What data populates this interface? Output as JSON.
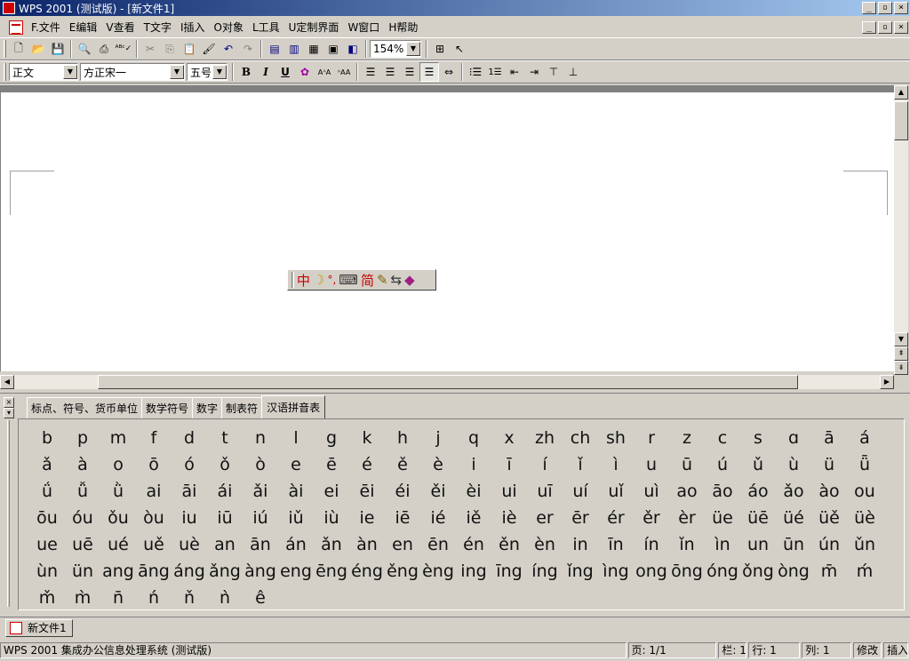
{
  "window": {
    "title": "WPS 2001 (测试版) - [新文件1]"
  },
  "menus": [
    "F.文件",
    "E编辑",
    "V查看",
    "T文字",
    "I插入",
    "O对象",
    "L工具",
    "U定制界面",
    "W窗口",
    "H帮助"
  ],
  "toolbar1": {
    "zoom": "154%",
    "icons": [
      "new-doc-icon",
      "open-folder-icon",
      "save-icon",
      "print-preview-icon",
      "print-icon",
      "spellcheck-icon",
      "cut-icon",
      "copy-icon",
      "paste-icon",
      "format-painter-icon",
      "undo-icon",
      "redo-icon",
      "columns-icon",
      "insert-column-icon",
      "table-icon",
      "image-icon",
      "frame-icon"
    ]
  },
  "toolbar2": {
    "style": "正文",
    "font": "方正宋一",
    "size": "五号",
    "buttons": {
      "bold": "B",
      "italic": "I",
      "underline": "U"
    }
  },
  "ime": {
    "glyphs": [
      "中",
      "☽",
      "°,",
      "⌨",
      "简",
      "✎",
      "⇆",
      "◆"
    ]
  },
  "panel": {
    "tabs": [
      "标点、符号、货币单位",
      "数学符号",
      "数字",
      "制表符",
      "汉语拼音表"
    ],
    "active_tab": "汉语拼音表",
    "pinyin": [
      "b",
      "p",
      "m",
      "f",
      "d",
      "t",
      "n",
      "l",
      "g",
      "k",
      "h",
      "j",
      "q",
      "x",
      "zh",
      "ch",
      "sh",
      "r",
      "z",
      "c",
      "s",
      "ɑ",
      "ā",
      "á",
      "ǎ",
      "à",
      "o",
      "ō",
      "ó",
      "ǒ",
      "ò",
      "e",
      "ē",
      "é",
      "ě",
      "è",
      "i",
      "ī",
      "í",
      "ǐ",
      "ì",
      "u",
      "ū",
      "ú",
      "ǔ",
      "ù",
      "ü",
      "ǖ",
      "ǘ",
      "ǚ",
      "ǜ",
      "ai",
      "āi",
      "ái",
      "ǎi",
      "ài",
      "ei",
      "ēi",
      "éi",
      "ěi",
      "èi",
      "ui",
      "uī",
      "uí",
      "uǐ",
      "uì",
      "ao",
      "āo",
      "áo",
      "ǎo",
      "ào",
      "ou",
      "ōu",
      "óu",
      "ǒu",
      "òu",
      "iu",
      "iū",
      "iú",
      "iǔ",
      "iù",
      "ie",
      "iē",
      "ié",
      "iě",
      "iè",
      "er",
      "ēr",
      "ér",
      "ěr",
      "èr",
      "üe",
      "üē",
      "üé",
      "üě",
      "üè",
      "ue",
      "uē",
      "ué",
      "uě",
      "uè",
      "an",
      "ān",
      "án",
      "ǎn",
      "àn",
      "en",
      "ēn",
      "én",
      "ěn",
      "èn",
      "in",
      "īn",
      "ín",
      "ǐn",
      "ìn",
      "un",
      "ūn",
      "ún",
      "ǔn",
      "ùn",
      "ün",
      "ang",
      "āng",
      "áng",
      "ǎng",
      "àng",
      "eng",
      "ēng",
      "éng",
      "ěng",
      "èng",
      "ing",
      "īng",
      "íng",
      "ǐng",
      "ìng",
      "ong",
      "ōng",
      "óng",
      "ǒng",
      "òng",
      "m̄",
      "ḿ",
      "m̌",
      "m̀",
      "n̄",
      "ń",
      "ň",
      "ǹ",
      "ê"
    ]
  },
  "doc_tab": "新文件1",
  "status": {
    "app": "WPS 2001 集成办公信息处理系统 (测试版)",
    "page": "页: 1/1",
    "col": "栏: 1",
    "row": "行: 1",
    "column": "列: 1",
    "modify": "修改",
    "insert": "插入"
  }
}
